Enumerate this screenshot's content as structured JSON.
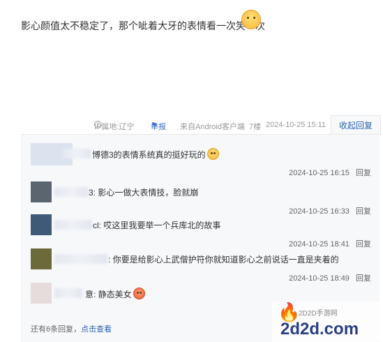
{
  "post": {
    "text": "影心颜值太不稳定了，那个呲着大牙的表情看一次笑一次",
    "emoji_icon": "laughing-face-emoji"
  },
  "meta": {
    "ip": "IP属地:辽宁",
    "report": "举报",
    "client": "来自Android客户端",
    "floor": "7楼",
    "time": "2024-10-25 15:11",
    "collapse": "收起回复"
  },
  "replies": [
    {
      "prefix": "..吧:",
      "text": "博德3的表情系统真的挺好玩的",
      "time": "2024-10-25 16:15",
      "reply_label": "回复",
      "emoji": "smile-emoji",
      "avatar_color": "#dbe3ef"
    },
    {
      "prefix": "3:",
      "text": "影心一做大表情技，脸就崩",
      "time": "2024-10-25 16:33",
      "reply_label": "回复",
      "emoji": "",
      "avatar_color": "#5b6570"
    },
    {
      "prefix": "cl:",
      "text": "哎这里我要举一个兵库北的故事",
      "time": "2024-10-25 18:41",
      "reply_label": "回复",
      "emoji": "",
      "avatar_color": "#3e5a78"
    },
    {
      "prefix": ":",
      "text": "你要是给影心上武僧护符你就知道影心之前说话一直是夹着的",
      "time": "2024-10-25 18:49",
      "reply_label": "回复",
      "emoji": "",
      "avatar_color": "#6b6a3a"
    },
    {
      "prefix": "意:",
      "text": "静态美女",
      "time": "",
      "reply_label": "",
      "emoji": "red-face-emoji",
      "avatar_color": "#e6dcdc"
    }
  ],
  "more": {
    "count_text": "还有6条回复，",
    "link": "点击查看"
  },
  "watermark": {
    "site": "2D2D手游网",
    "name": "2d2d.com"
  }
}
